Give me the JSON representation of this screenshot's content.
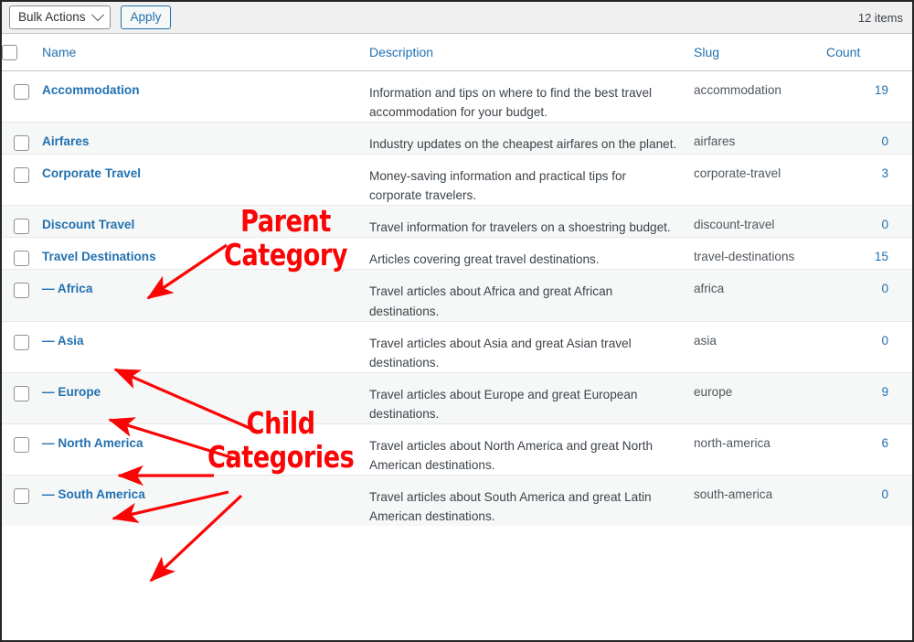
{
  "toolbar": {
    "bulk_actions_label": "Bulk Actions",
    "apply_label": "Apply",
    "items_count": "12 items"
  },
  "table": {
    "columns": {
      "name": "Name",
      "description": "Description",
      "slug": "Slug",
      "count": "Count"
    },
    "rows": [
      {
        "name": "Accommodation",
        "prefix": "",
        "description": "Information and tips on where to find the best travel accommodation for your budget.",
        "slug": "accommodation",
        "count": "19"
      },
      {
        "name": "Airfares",
        "prefix": "",
        "description": "Industry updates on the cheapest airfares on the planet.",
        "slug": "airfares",
        "count": "0"
      },
      {
        "name": "Corporate Travel",
        "prefix": "",
        "description": "Money-saving information and practical tips for corporate travelers.",
        "slug": "corporate-travel",
        "count": "3"
      },
      {
        "name": "Discount Travel",
        "prefix": "",
        "description": "Travel information for travelers on a shoestring budget.",
        "slug": "discount-travel",
        "count": "0"
      },
      {
        "name": "Travel Destinations",
        "prefix": "",
        "description": "Articles covering great travel destinations.",
        "slug": "travel-destinations",
        "count": "15"
      },
      {
        "name": "Africa",
        "prefix": "— ",
        "description": "Travel articles about Africa and great African destinations.",
        "slug": "africa",
        "count": "0"
      },
      {
        "name": "Asia",
        "prefix": "— ",
        "description": "Travel articles about Asia and great Asian travel destinations.",
        "slug": "asia",
        "count": "0"
      },
      {
        "name": "Europe",
        "prefix": "— ",
        "description": "Travel articles about Europe and great European destinations.",
        "slug": "europe",
        "count": "9"
      },
      {
        "name": "North America",
        "prefix": "— ",
        "description": "Travel articles about North America and great North American destinations.",
        "slug": "north-america",
        "count": "6"
      },
      {
        "name": "South America",
        "prefix": "— ",
        "description": "Travel articles about South America and great Latin American destinations.",
        "slug": "south-america",
        "count": "0"
      }
    ]
  },
  "annotations": {
    "accent_color": "#fa0505",
    "parent_label": "Parent\nCategory",
    "child_label": "Child\nCategories"
  }
}
